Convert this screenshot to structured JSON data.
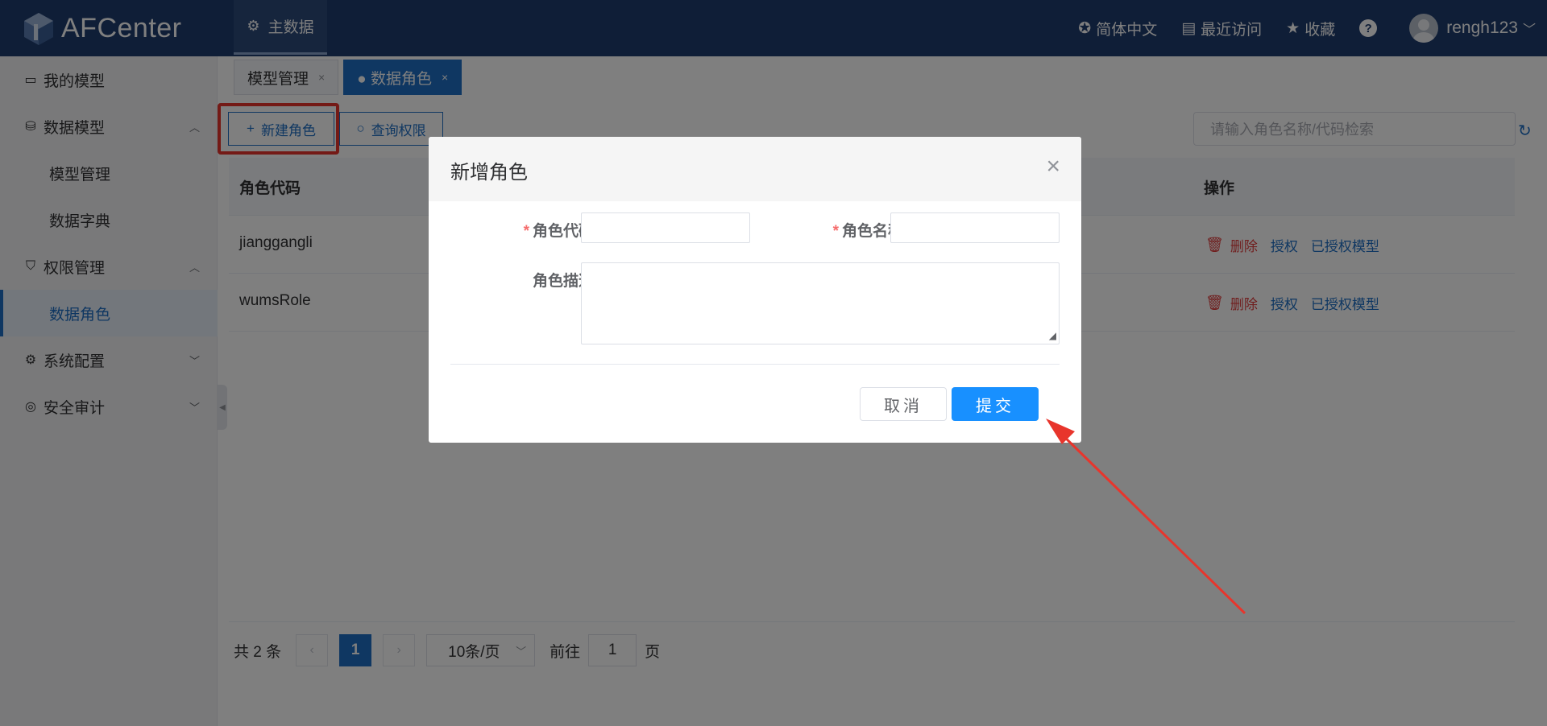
{
  "app": {
    "name": "AFCenter"
  },
  "topbar": {
    "main_nav": "主数据",
    "language": "简体中文",
    "recent": "最近访问",
    "favorites": "收藏",
    "help": "?",
    "username": "rengh123"
  },
  "sidebar": {
    "items": [
      {
        "label": "我的模型",
        "icon": "wallet-icon"
      },
      {
        "label": "数据模型",
        "icon": "database-icon",
        "expanded": true
      },
      {
        "label": "模型管理"
      },
      {
        "label": "数据字典"
      },
      {
        "label": "权限管理",
        "icon": "shield-icon",
        "expanded": true
      },
      {
        "label": "数据角色",
        "active": true
      },
      {
        "label": "系统配置",
        "icon": "gear-icon",
        "expanded": false
      },
      {
        "label": "安全审计",
        "icon": "audit-icon",
        "expanded": false
      }
    ]
  },
  "tabs": [
    {
      "label": "模型管理",
      "close": "×"
    },
    {
      "label": "● 数据角色",
      "close": "×",
      "active": true
    }
  ],
  "toolbar": {
    "new_role": "新建角色",
    "query_perm": "查询权限",
    "search_placeholder": "请输入角色名称/代码检索"
  },
  "table": {
    "headers": {
      "code": "角色代码",
      "ops": "操作"
    },
    "rows": [
      {
        "code": "jianggangli"
      },
      {
        "code": "wumsRole"
      }
    ],
    "actions": {
      "delete": "删除",
      "grant": "授权",
      "granted_models": "已授权模型"
    }
  },
  "pagination": {
    "total": "共 2 条",
    "current": "1",
    "page_size": "10条/页",
    "goto_label": "前往",
    "goto_value": "1",
    "page_unit": "页"
  },
  "dialog": {
    "title": "新增角色",
    "close": "×",
    "field_code_label": "角色代码",
    "field_name_label": "角色名称",
    "field_desc_label": "角色描述",
    "required_mark": "*",
    "cancel": "取消",
    "submit": "提交"
  },
  "colors": {
    "topbar": "#1f3c6e",
    "accent": "#1f6fc4",
    "submit": "#1890ff",
    "danger": "#e03c3c",
    "annotation": "#e8352c"
  }
}
